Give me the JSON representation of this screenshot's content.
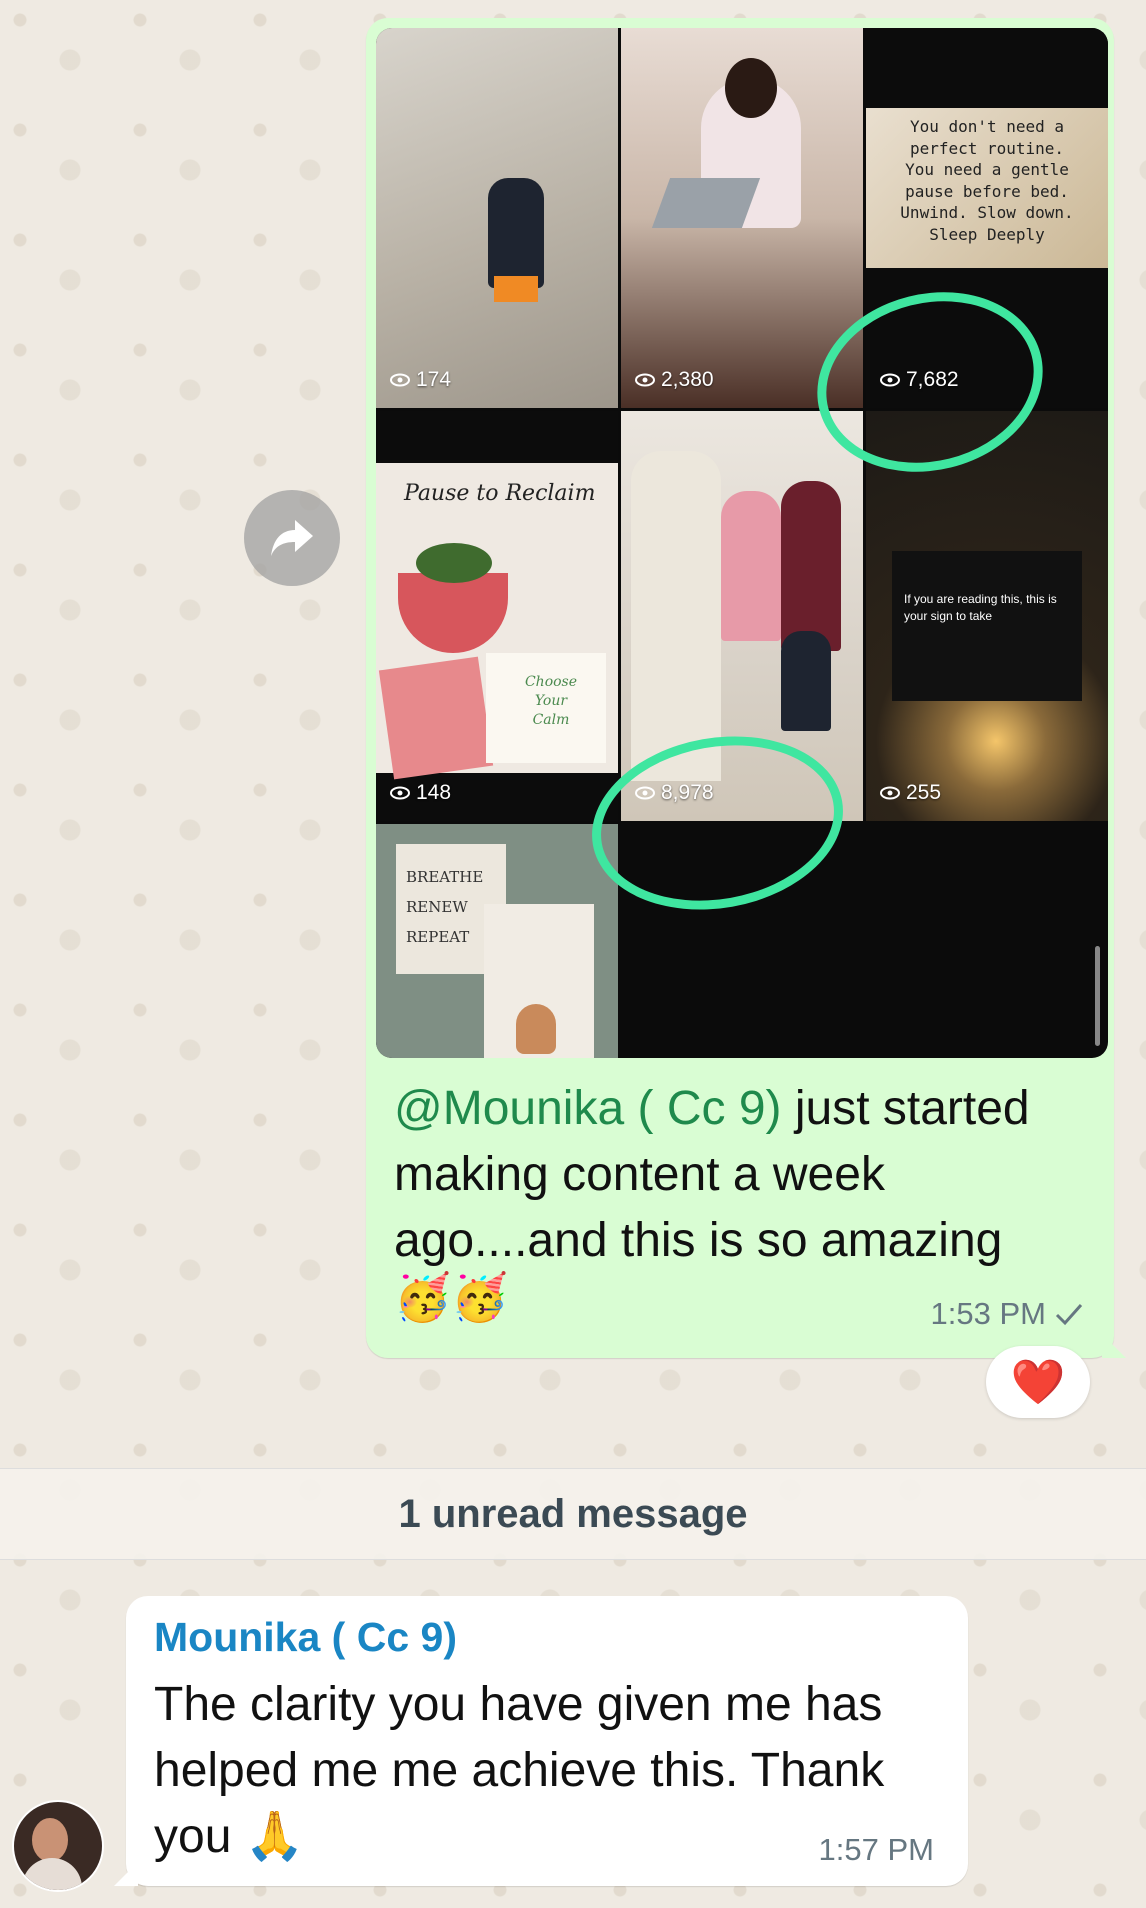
{
  "sent_message": {
    "mention": "@Mounika ( Cc 9)",
    "text": " just started making content a week ago....and this is so amazing",
    "emojis": "🥳🥳",
    "time": "1:53 PM",
    "reaction": "❤️",
    "tiles": [
      {
        "views": "174",
        "image": "boy-in-kitchen"
      },
      {
        "views": "2,380",
        "image": "woman-on-laptop"
      },
      {
        "views": "7,682",
        "image": "quote-card"
      },
      {
        "views": "148",
        "image": "pause-to-reclaim-journal"
      },
      {
        "views": "8,978",
        "image": "family-scene"
      },
      {
        "views": "255",
        "image": "candle-sign"
      },
      {
        "views": "",
        "image": "breathe-renew-repeat"
      }
    ],
    "quote_text": "You don't need a\nperfect routine.\nYou need a gentle\npause before bed.\nUnwind. Slow down.\nSleep Deeply",
    "pause_title": "Pause to Reclaim",
    "journal_text": "Choose\nYour\nCalm",
    "sign_text": "If you are reading this, this is your sign to take",
    "breathe_text": "BREATHE\nRENEW\nREPEAT"
  },
  "unread_label": "1 unread message",
  "received_message": {
    "sender": "Mounika ( Cc 9)",
    "text": "The clarity you have given me has helped me me achieve this. Thank you 🙏",
    "time": "1:57 PM"
  },
  "colors": {
    "sent_bubble": "#d9fdd3",
    "received_bubble": "#ffffff",
    "mention": "#1f8a4c",
    "sender_name": "#1a86c4",
    "highlight_circle": "#3fe6a0"
  }
}
